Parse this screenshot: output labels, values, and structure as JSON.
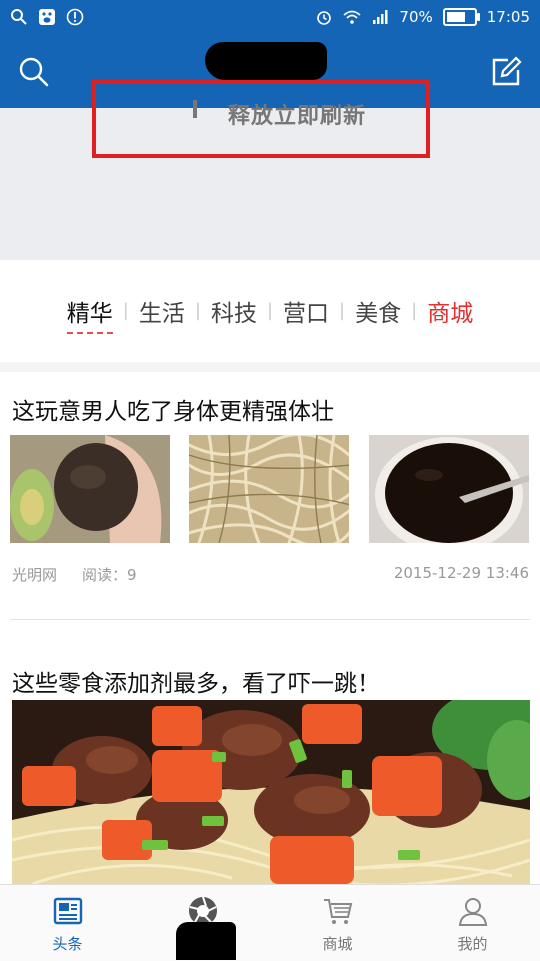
{
  "status_bar": {
    "battery": "70%",
    "battery_level": 0.7,
    "time": "17:05"
  },
  "header": {
    "search_icon": "search-icon",
    "compose_icon": "compose-icon"
  },
  "pull_refresh": {
    "text": "释放立即刷新"
  },
  "tabs": [
    {
      "label": "精华",
      "active": true
    },
    {
      "label": "生活"
    },
    {
      "label": "科技"
    },
    {
      "label": "营口"
    },
    {
      "label": "美食"
    },
    {
      "label": "商城",
      "accent": "#e03030"
    }
  ],
  "feed": {
    "article1": {
      "title": "这玩意男人吃了身体更精强体壮",
      "source": "光明网",
      "reads": "阅读：9",
      "date": "2015-12-29 13:46"
    },
    "article2": {
      "title": "这些零食添加剂最多，看了吓一跳！"
    }
  },
  "bottom_nav": [
    {
      "label": "头条",
      "icon": "news-icon",
      "active": true
    },
    {
      "label": "",
      "icon": "camera-aperture-icon"
    },
    {
      "label": "商城",
      "icon": "cart-icon"
    },
    {
      "label": "我的",
      "icon": "user-icon"
    }
  ],
  "colors": {
    "brand_blue": "#1565b7",
    "highlight_red": "#e02020",
    "store_red": "#e03030"
  }
}
